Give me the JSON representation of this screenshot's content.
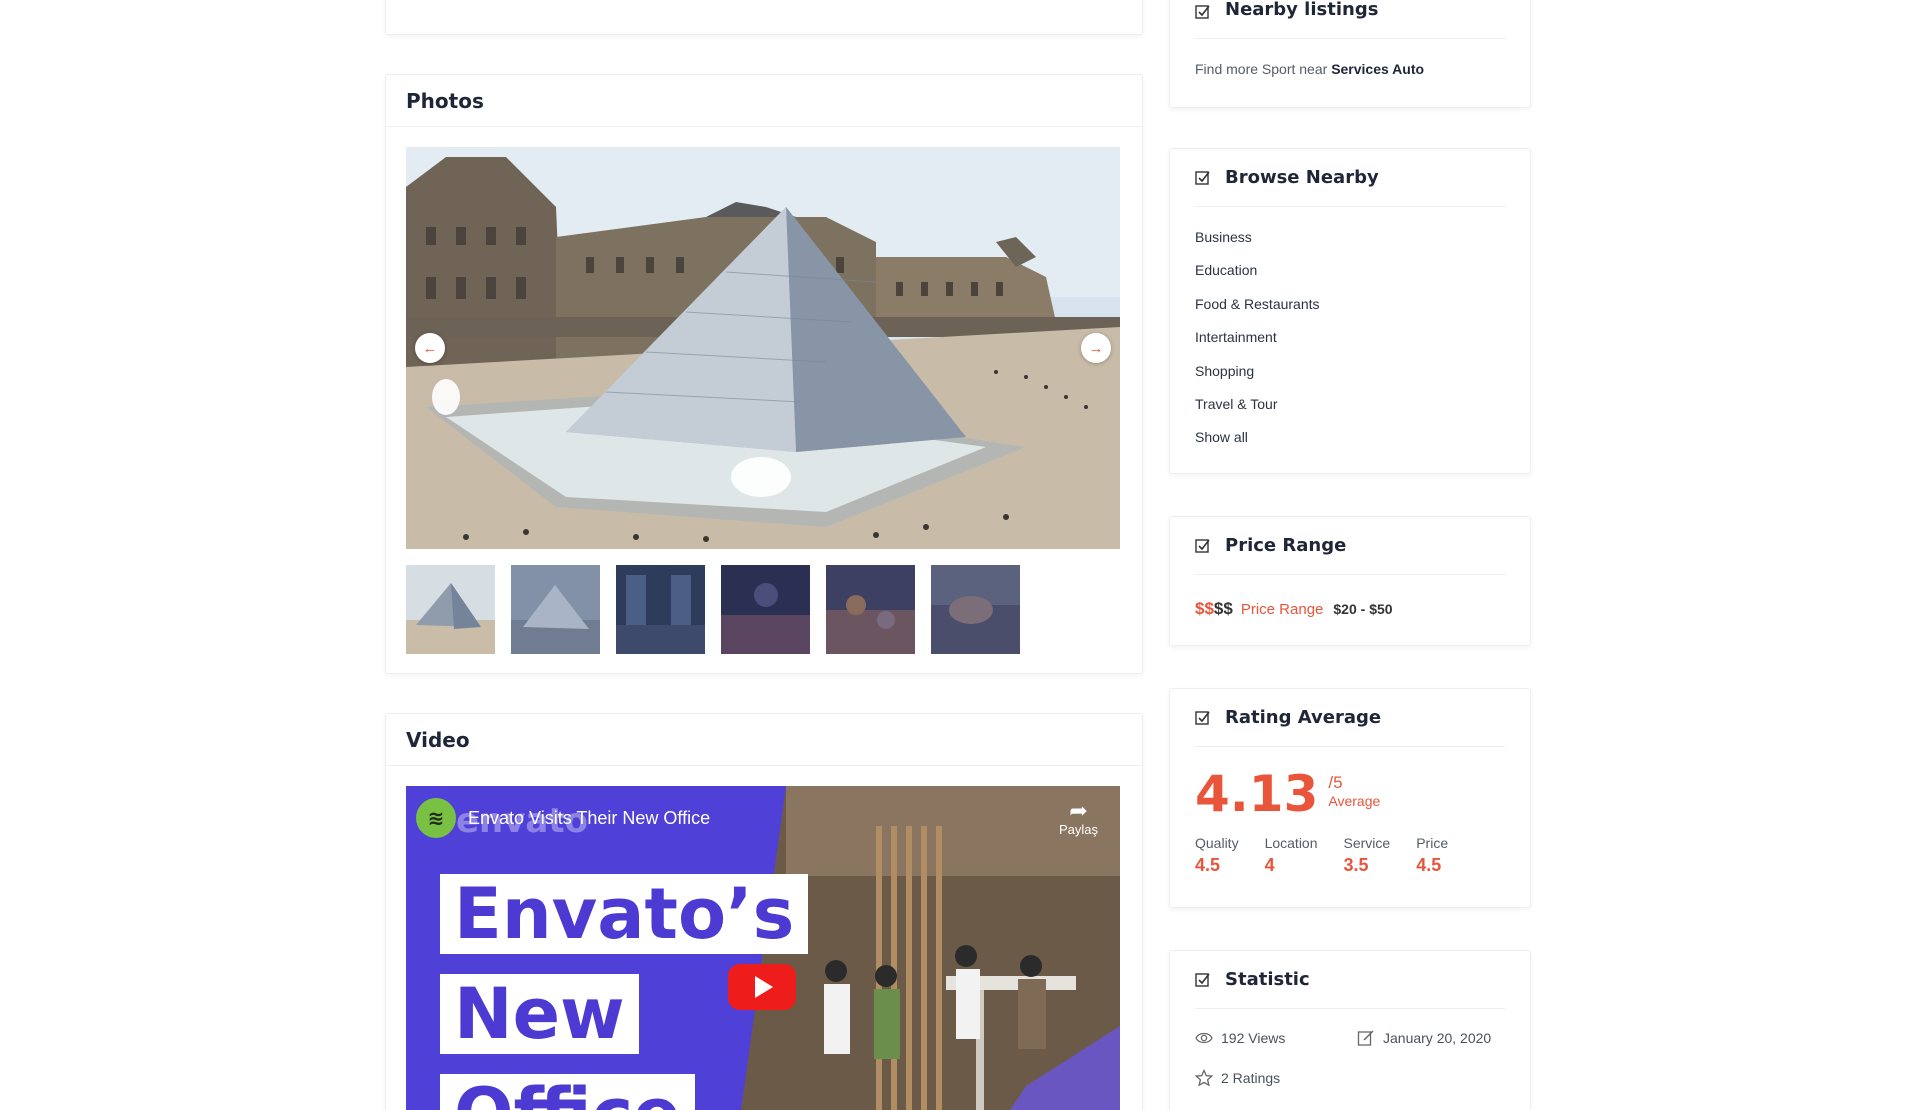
{
  "photos": {
    "title": "Photos",
    "prev_icon": "arrow-left-icon",
    "next_icon": "arrow-right-icon",
    "thumbnail_count_visible": 6
  },
  "video": {
    "section_title": "Video",
    "channel_logo": "envato-logo-icon",
    "title": "Envato Visits Their New Office",
    "share_label": "Paylaş",
    "overlay_words": [
      "Envato’s",
      "New",
      "Office"
    ],
    "play_icon": "youtube-play-icon"
  },
  "nearby": {
    "title": "Nearby listings",
    "text_prefix": "Find more Sport near",
    "text_place": "Services Auto"
  },
  "browse": {
    "title": "Browse Nearby",
    "items": [
      "Business",
      "Education",
      "Food & Restaurants",
      "Intertainment",
      "Shopping",
      "Travel & Tour",
      "Show all"
    ]
  },
  "price": {
    "title": "Price Range",
    "dollars_active": "$$",
    "dollars_inactive": "$$",
    "label": "Price Range",
    "value": "$20 - $50"
  },
  "rating": {
    "title": "Rating Average",
    "average": "4.13",
    "out_of": "/5",
    "average_label": "Average",
    "items": [
      {
        "label": "Quality",
        "value": "4.5"
      },
      {
        "label": "Location",
        "value": "4"
      },
      {
        "label": "Service",
        "value": "3.5"
      },
      {
        "label": "Price",
        "value": "4.5"
      }
    ]
  },
  "statistic": {
    "title": "Statistic",
    "views": "192 Views",
    "date": "January 20, 2020",
    "ratings": "2 Ratings"
  },
  "colors": {
    "accent": "#e8553b",
    "heading": "#1e2637",
    "video_purple": "#4c3ad3",
    "youtube_red": "#ee1c1b"
  }
}
